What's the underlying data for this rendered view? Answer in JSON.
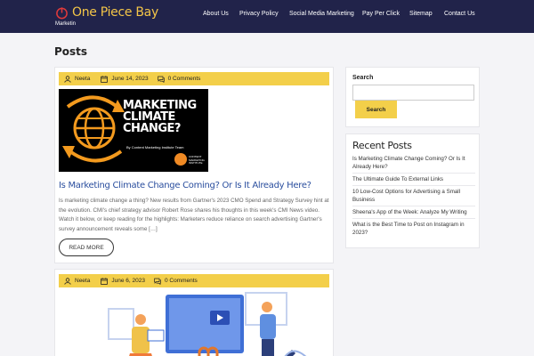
{
  "header": {
    "logo_text": "One Piece Bay",
    "tagline": "Marketin",
    "nav": [
      {
        "label": "About Us"
      },
      {
        "label": "Privacy Policy"
      },
      {
        "label": "Social Media Marketing"
      },
      {
        "label": "Pay Per Click"
      },
      {
        "label": "Sitemap"
      },
      {
        "label": "Contact Us"
      }
    ]
  },
  "page": {
    "title": "Posts"
  },
  "posts": [
    {
      "author": "Neeta",
      "date": "June 14, 2023",
      "comments": "0 Comments",
      "thumb": {
        "title_lines": [
          "MARKETING",
          "CLIMATE",
          "CHANGE?"
        ],
        "subtitle": "By Content Marketing Institute Team",
        "badge_text": "CONTENT MARKETING INSTITUTE"
      },
      "title": "Is Marketing Climate Change Coming? Or Is It Already Here?",
      "excerpt": "Is marketing climate change a thing? New results from Gartner's 2023 CMO Spend and Strategy Survey hint at the evolution. CMI's chief strategy advisor Robert Rose shares his thoughts in this week's CMI News video. Watch it below, or keep reading for the highlights: Marketers reduce reliance on search advertising Gartner's survey announcement reveals some […]",
      "read_more": "READ MORE"
    },
    {
      "author": "Neeta",
      "date": "June 6, 2023",
      "comments": "0 Comments"
    }
  ],
  "sidebar": {
    "search": {
      "title": "Search",
      "placeholder": "",
      "button": "Search"
    },
    "recent": {
      "title": "Recent Posts",
      "items": [
        {
          "label": "Is Marketing Climate Change Coming? Or Is It Already Here?"
        },
        {
          "label": "The Ultimate Guide To External Links"
        },
        {
          "label": "10 Low-Cost Options for Advertising a Small Business"
        },
        {
          "label": "Sheena's App of the Week: Analyze My Writing"
        },
        {
          "label": "What is the Best Time to Post on Instagram in 2023?"
        }
      ]
    }
  },
  "colors": {
    "header_bg": "#21234a",
    "accent_yellow": "#f3cf4a",
    "logo_color": "#f3c548",
    "link_blue": "#2a4e9e",
    "thumb_glow": "#f39a1e"
  }
}
